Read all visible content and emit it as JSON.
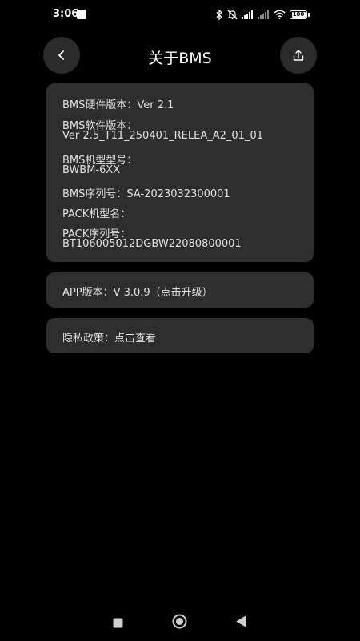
{
  "status_bar": {
    "time": "3:06",
    "battery": "100",
    "icons": [
      "bluetooth-icon",
      "mute-icon",
      "signal-icon",
      "signal-icon",
      "wifi-icon",
      "battery-icon"
    ]
  },
  "header": {
    "title": "关于BMS",
    "back_icon": "chevron-left-icon",
    "share_icon": "share-icon"
  },
  "info": {
    "hardware_label": "BMS硬件版本：",
    "hardware_value": "Ver 2.1",
    "software_label": "BMS软件版本：",
    "software_value": "Ver 2.5_T11_250401_RELEA_A2_01_01",
    "model_label": "BMS机型型号：",
    "model_value": "BWBM-6XX",
    "serial_label": "BMS序列号：",
    "serial_value": "SA-2023032300001",
    "pack_model_label": "PACK机型名：",
    "pack_model_value": "",
    "pack_serial_label": "PACK序列号：",
    "pack_serial_value": "BT106005012DGBW22080800001"
  },
  "app": {
    "label": "APP版本：",
    "value": "V 3.0.9（点击升级）"
  },
  "privacy": {
    "label": "隐私政策：",
    "value": "点击查看"
  },
  "colors": {
    "background": "#000000",
    "card": "#2e2e2e",
    "button": "#2b2b2b",
    "text": "#e0e0e0"
  }
}
